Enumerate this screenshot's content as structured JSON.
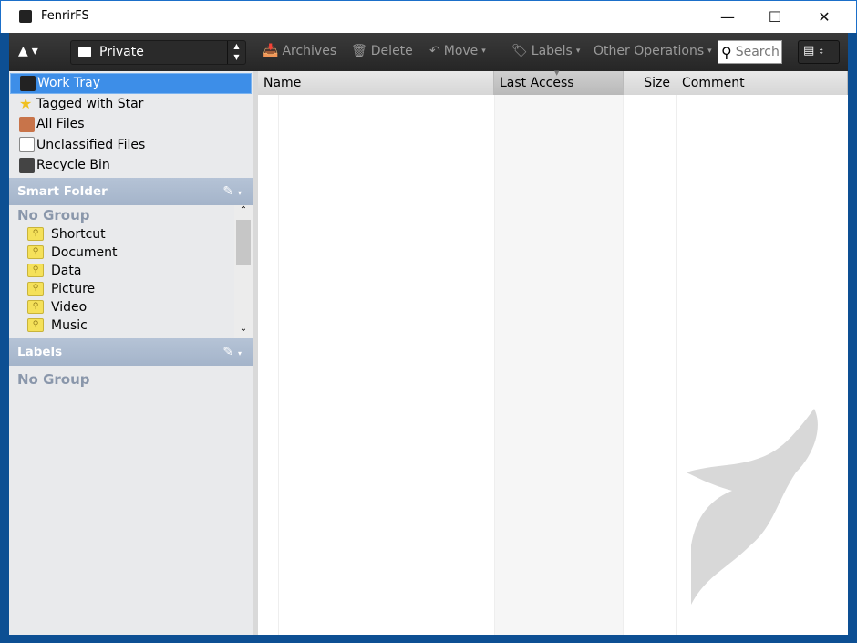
{
  "window": {
    "title": "FenrirFS"
  },
  "toolbar": {
    "profile": "Private",
    "archives": "Archives",
    "delete": "Delete",
    "move": "Move",
    "labels": "Labels",
    "other": "Other Operations",
    "search_placeholder": "Search"
  },
  "sidebar": {
    "items": [
      {
        "label": "Work Tray",
        "icon": "tray-icon"
      },
      {
        "label": "Tagged with Star",
        "icon": "star-icon"
      },
      {
        "label": "All Files",
        "icon": "box-icon"
      },
      {
        "label": "Unclassified Files",
        "icon": "file-icon"
      },
      {
        "label": "Recycle Bin",
        "icon": "trash-icon"
      }
    ],
    "smart_folder": {
      "title": "Smart Folder",
      "group": "No Group",
      "items": [
        "Shortcut",
        "Document",
        "Data",
        "Picture",
        "Video",
        "Music"
      ]
    },
    "labels": {
      "title": "Labels",
      "group": "No Group"
    }
  },
  "table": {
    "columns": [
      "Name",
      "Last Access",
      "Size",
      "Comment"
    ],
    "sorted_column": "Last Access"
  },
  "colors": {
    "selection": "#3d8ee8",
    "toolbar": "#2b2b2b",
    "section": "#a9b8cc"
  }
}
